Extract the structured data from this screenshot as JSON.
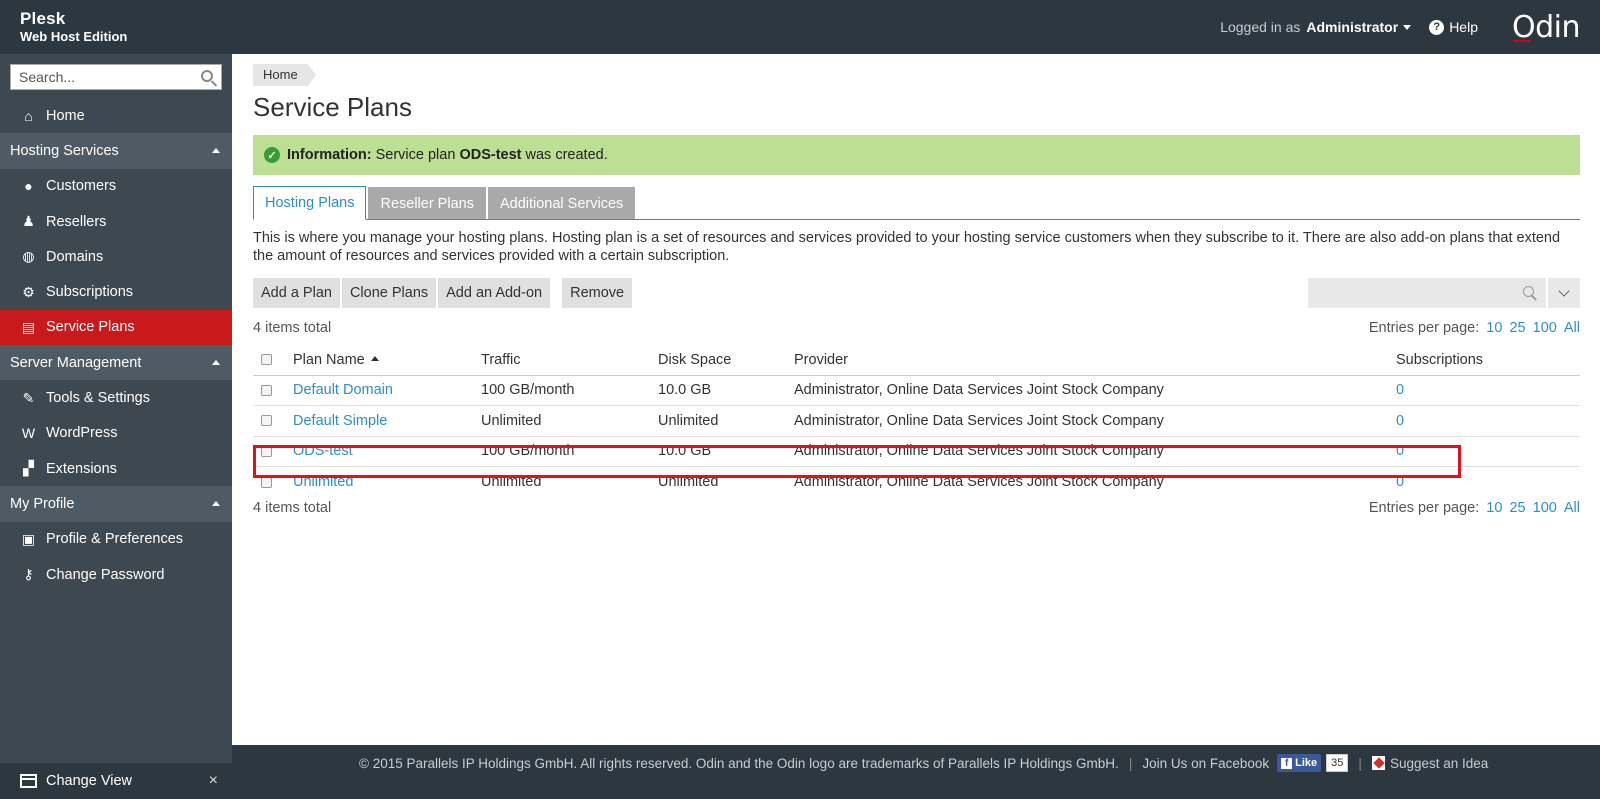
{
  "header": {
    "brand_line1": "Plesk",
    "brand_line2": "Web Host Edition",
    "logged_in_prefix": "Logged in as",
    "user": "Administrator",
    "help": "Help",
    "logo": "Odin"
  },
  "sidebar": {
    "search_placeholder": "Search...",
    "items": [
      {
        "type": "item",
        "label": "Home",
        "icon": "house-icon",
        "glyph": "⌂"
      },
      {
        "type": "group",
        "label": "Hosting Services"
      },
      {
        "type": "item",
        "label": "Customers",
        "icon": "person-icon",
        "glyph": "●"
      },
      {
        "type": "item",
        "label": "Resellers",
        "icon": "reseller-icon",
        "glyph": "♟"
      },
      {
        "type": "item",
        "label": "Domains",
        "icon": "globe-icon",
        "glyph": "◍"
      },
      {
        "type": "item",
        "label": "Subscriptions",
        "icon": "gear-icon",
        "glyph": "⚙"
      },
      {
        "type": "item",
        "label": "Service Plans",
        "icon": "clipboard-icon",
        "glyph": "▤",
        "active": true
      },
      {
        "type": "group",
        "label": "Server Management"
      },
      {
        "type": "item",
        "label": "Tools & Settings",
        "icon": "tools-icon",
        "glyph": "✎"
      },
      {
        "type": "item",
        "label": "WordPress",
        "icon": "wordpress-icon",
        "glyph": "W"
      },
      {
        "type": "item",
        "label": "Extensions",
        "icon": "blocks-icon",
        "glyph": "▞"
      },
      {
        "type": "group",
        "label": "My Profile"
      },
      {
        "type": "item",
        "label": "Profile & Preferences",
        "icon": "profile-card-icon",
        "glyph": "▣"
      },
      {
        "type": "item",
        "label": "Change Password",
        "icon": "key-icon",
        "glyph": "⚷"
      }
    ],
    "change_view": "Change View",
    "close": "×"
  },
  "main": {
    "breadcrumb": "Home",
    "title": "Service Plans",
    "info_label": "Information:",
    "info_text_1": "Service plan",
    "info_plan": "ODS-test",
    "info_text_2": "was created.",
    "tabs": [
      "Hosting Plans",
      "Reseller Plans",
      "Additional Services"
    ],
    "description": "This is where you manage your hosting plans. Hosting plan is a set of resources and services provided to your hosting service customers when they subscribe to it. There are also add-on plans that extend the amount of resources and services provided with a certain subscription.",
    "toolbar": {
      "add_plan": "Add a Plan",
      "clone_plans": "Clone Plans",
      "add_addon": "Add an Add-on",
      "remove": "Remove"
    },
    "items_total": "4 items total",
    "entries_label": "Entries per page:",
    "entries_options": [
      "10",
      "25",
      "100",
      "All"
    ],
    "table": {
      "columns": [
        "Plan Name",
        "Traffic",
        "Disk Space",
        "Provider",
        "Subscriptions"
      ],
      "rows": [
        {
          "name": "Default Domain",
          "traffic": "100 GB/month",
          "disk": "10.0 GB",
          "provider": "Administrator, Online Data Services Joint Stock Company",
          "subs": "0"
        },
        {
          "name": "Default Simple",
          "traffic": "Unlimited",
          "disk": "Unlimited",
          "provider": "Administrator, Online Data Services Joint Stock Company",
          "subs": "0"
        },
        {
          "name": "ODS-test",
          "traffic": "100 GB/month",
          "disk": "10.0 GB",
          "provider": "Administrator, Online Data Services Joint Stock Company",
          "subs": "0"
        },
        {
          "name": "Unlimited",
          "traffic": "Unlimited",
          "disk": "Unlimited",
          "provider": "Administrator, Online Data Services Joint Stock Company",
          "subs": "0"
        }
      ]
    }
  },
  "footer": {
    "copyright": "© 2015 Parallels IP Holdings GmbH. All rights reserved. Odin and the Odin logo are trademarks of Parallels IP Holdings GmbH.",
    "join_facebook": "Join Us on Facebook",
    "like": "Like",
    "like_count": "35",
    "suggest": "Suggest an Idea"
  },
  "colors": {
    "header_bg": "#2c3740",
    "sidebar_bg": "#3d4850",
    "active_nav": "#c8191b",
    "link": "#2e8fc4",
    "info_bg": "#bcdf94",
    "highlight": "#e0131d"
  }
}
